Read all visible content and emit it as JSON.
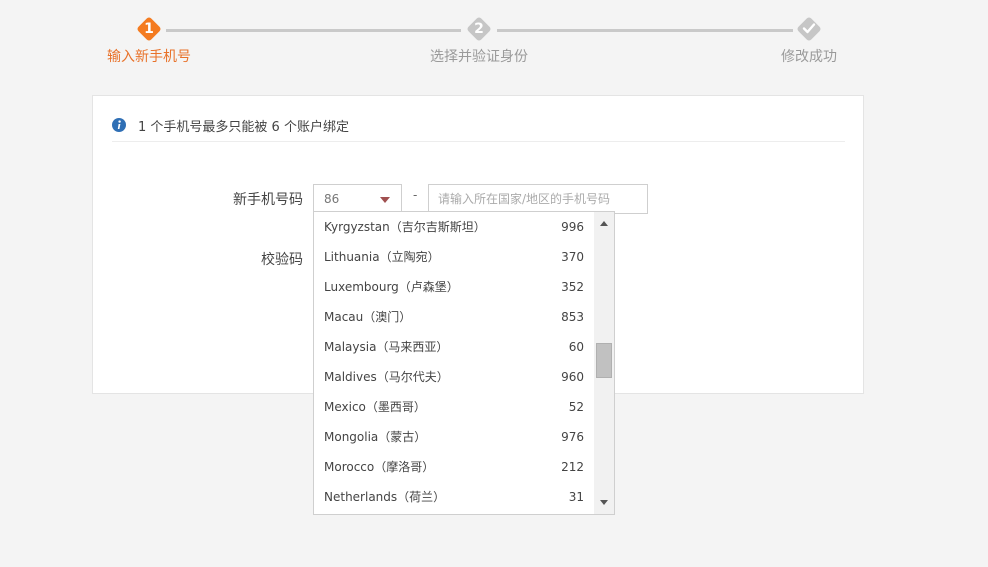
{
  "stepper": {
    "steps": [
      {
        "number": "1",
        "label": "输入新手机号",
        "state": "active"
      },
      {
        "number": "2",
        "label": "选择并验证身份",
        "state": "pending"
      },
      {
        "number": "",
        "label": "修改成功",
        "icon": "check-icon",
        "state": "pending"
      }
    ],
    "active_color": "#f47b20",
    "inactive_color": "#c6c6c6"
  },
  "notice": {
    "icon": "info-icon",
    "text": "1 个手机号最多只能被 6 个账户绑定"
  },
  "form": {
    "phone_label": "新手机号码",
    "code_label": "校验码",
    "country_code": "86",
    "dash": "-",
    "phone_placeholder": "请输入所在国家/地区的手机号码",
    "phone_value": ""
  },
  "country_dropdown": {
    "items": [
      {
        "name": "Kyrgyzstan（吉尔吉斯斯坦）",
        "code": "996"
      },
      {
        "name": "Lithuania（立陶宛）",
        "code": "370"
      },
      {
        "name": "Luxembourg（卢森堡）",
        "code": "352"
      },
      {
        "name": "Macau（澳门）",
        "code": "853"
      },
      {
        "name": "Malaysia（马来西亚）",
        "code": "60"
      },
      {
        "name": "Maldives（马尔代夫）",
        "code": "960"
      },
      {
        "name": "Mexico（墨西哥）",
        "code": "52"
      },
      {
        "name": "Mongolia（蒙古）",
        "code": "976"
      },
      {
        "name": "Morocco（摩洛哥）",
        "code": "212"
      },
      {
        "name": "Netherlands（荷兰）",
        "code": "31"
      }
    ]
  }
}
